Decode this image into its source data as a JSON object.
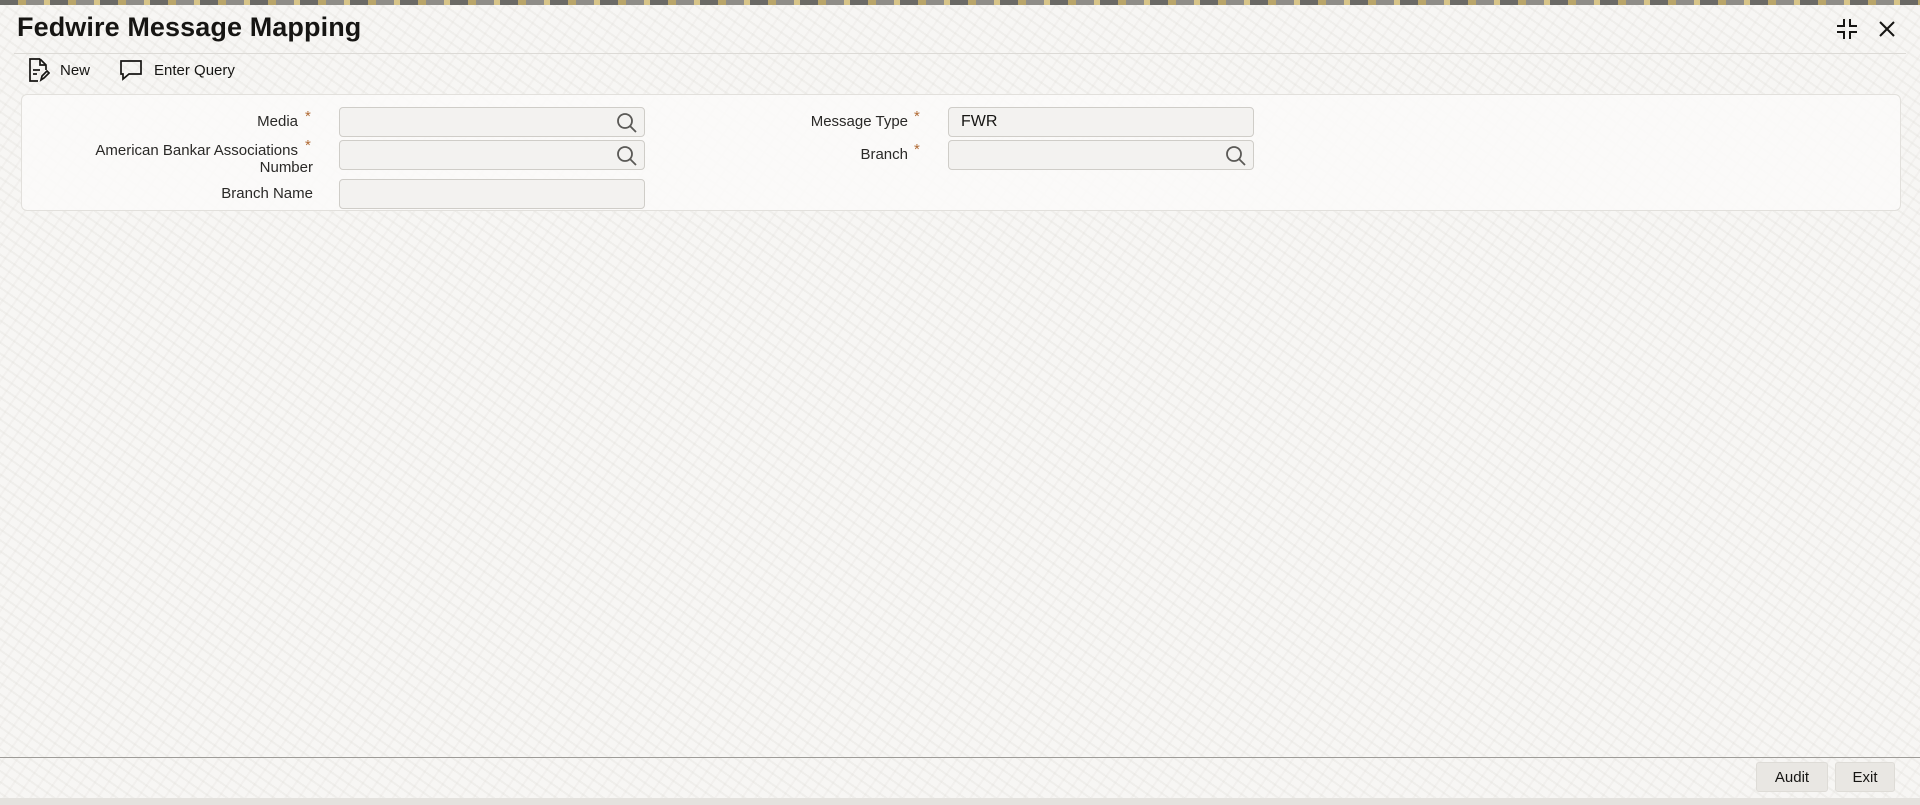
{
  "window": {
    "title": "Fedwire Message Mapping",
    "controls": {
      "restore_icon": "collapse-icon",
      "close_icon": "close-icon"
    }
  },
  "toolbar": {
    "new_label": "New",
    "new_icon": "new-document-icon",
    "enter_query_label": "Enter Query",
    "enter_query_icon": "speech-bubble-icon"
  },
  "form": {
    "media": {
      "label": "Media",
      "required": "*",
      "value": "",
      "lookup_icon": "search-icon"
    },
    "aba_number": {
      "label_line1": "American Bankar Associations",
      "label_line2": "Number",
      "required": "*",
      "value": "",
      "lookup_icon": "search-icon"
    },
    "branch_name": {
      "label": "Branch Name",
      "value": ""
    },
    "message_type": {
      "label": "Message Type",
      "required": "*",
      "value": "FWR"
    },
    "branch": {
      "label": "Branch",
      "required": "*",
      "value": "",
      "lookup_icon": "search-icon"
    }
  },
  "footer": {
    "audit_label": "Audit",
    "exit_label": "Exit"
  },
  "colors": {
    "required_marker": "#b06a34",
    "background": "#f7f6f4",
    "field_bg": "#f3f2f0",
    "footer_button": "#e9e7e3"
  }
}
